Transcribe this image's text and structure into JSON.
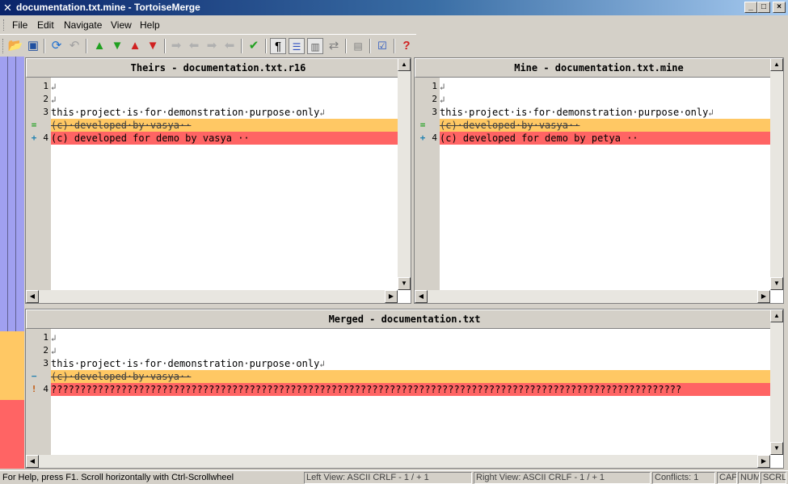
{
  "window": {
    "title": "documentation.txt.mine - TortoiseMerge",
    "controls": {
      "minimize": "_",
      "maximize": "□",
      "close": "×"
    }
  },
  "menu": [
    "File",
    "Edit",
    "Navigate",
    "View",
    "Help"
  ],
  "toolbar": {
    "icons": [
      "open-icon",
      "save-icon",
      "reload-icon",
      "undo-icon",
      "prev-diff-icon",
      "next-diff-icon",
      "prev-conflict-icon",
      "next-conflict-icon",
      "use-theirs-block-icon",
      "use-mine-block-icon",
      "use-theirs-then-mine-icon",
      "use-mine-then-theirs-icon",
      "mark-resolved-icon",
      "show-whitespace-icon",
      "one-pane-view-icon",
      "two-pane-view-icon",
      "swap-views-icon",
      "patch-list-icon",
      "settings-icon",
      "help-icon"
    ]
  },
  "panes": {
    "theirs": {
      "title": "Theirs - documentation.txt.r16",
      "lines": [
        {
          "num": "1",
          "text": "",
          "state": "normal",
          "marker": ""
        },
        {
          "num": "2",
          "text": "",
          "state": "normal",
          "marker": ""
        },
        {
          "num": "3",
          "text": "this·project·is·for·demonstration·purpose·only",
          "state": "normal",
          "marker": ""
        },
        {
          "num": "",
          "text": "(c)·developed·by·vasya··",
          "state": "deleted",
          "marker": "="
        },
        {
          "num": "4",
          "text": "(c) developed for demo by vasya ··",
          "state": "changed",
          "marker": "+"
        }
      ]
    },
    "mine": {
      "title": "Mine - documentation.txt.mine",
      "lines": [
        {
          "num": "1",
          "text": "",
          "state": "normal",
          "marker": ""
        },
        {
          "num": "2",
          "text": "",
          "state": "normal",
          "marker": ""
        },
        {
          "num": "3",
          "text": "this·project·is·for·demonstration·purpose·only",
          "state": "normal",
          "marker": ""
        },
        {
          "num": "",
          "text": "(c)·developed·by·vasya··",
          "state": "deleted",
          "marker": "="
        },
        {
          "num": "4",
          "text": "(c) developed for demo by petya ··",
          "state": "changed",
          "marker": "+"
        }
      ]
    },
    "merged": {
      "title": "Merged - documentation.txt",
      "lines": [
        {
          "num": "1",
          "text": "",
          "state": "normal",
          "marker": ""
        },
        {
          "num": "2",
          "text": "",
          "state": "normal",
          "marker": ""
        },
        {
          "num": "3",
          "text": "this·project·is·for·demonstration·purpose·only",
          "state": "normal",
          "marker": ""
        },
        {
          "num": "",
          "text": "(c)·developed·by·vasya··",
          "state": "deleted",
          "marker": "−"
        },
        {
          "num": "4",
          "text": "????????????????????????????????????????????????????????????????????????????????????????????????????????????",
          "state": "changed",
          "marker": "!"
        }
      ]
    }
  },
  "statusbar": {
    "help": "For Help, press F1. Scroll horizontally with Ctrl-Scrollwheel",
    "left_view": "Left View: ASCII CRLF  - 1 / + 1",
    "right_view": "Right View: ASCII CRLF  - 1 / + 1",
    "conflicts": "Conflicts: 1",
    "cap": "CAP",
    "num": "NUM",
    "scrl": "SCRL"
  },
  "colors": {
    "deleted": "#ffc864",
    "changed": "#ff6464",
    "strip_blue": "#a0a0f0",
    "title_start": "#0a246a"
  }
}
